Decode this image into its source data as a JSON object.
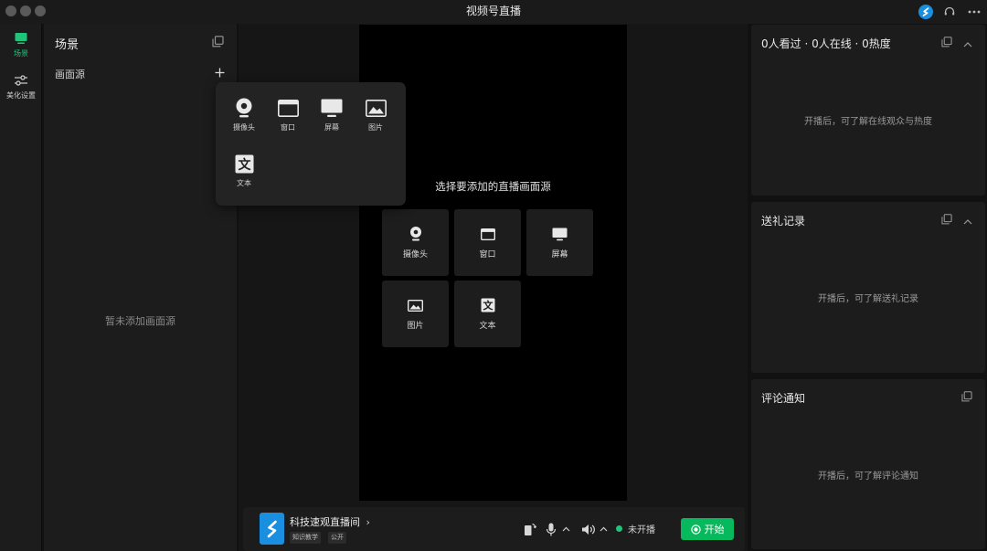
{
  "app": {
    "title": "视频号直播"
  },
  "sidebar": {
    "items": [
      {
        "label": "场景",
        "icon": "scene-icon",
        "active": true
      },
      {
        "label": "美化设置",
        "icon": "beauty-settings-icon",
        "active": false
      }
    ]
  },
  "scene_panel": {
    "title": "场景",
    "sources_label": "画面源",
    "empty_text": "暂未添加画面源"
  },
  "source_popup": {
    "items": [
      {
        "label": "摄像头",
        "icon": "camera-icon"
      },
      {
        "label": "窗口",
        "icon": "window-icon"
      },
      {
        "label": "屏幕",
        "icon": "screen-icon"
      },
      {
        "label": "图片",
        "icon": "image-icon"
      },
      {
        "label": "文本",
        "icon": "text-icon"
      }
    ]
  },
  "preview": {
    "prompt": "选择要添加的直播画面源",
    "tiles": [
      {
        "label": "摄像头",
        "icon": "camera-icon"
      },
      {
        "label": "窗口",
        "icon": "window-icon"
      },
      {
        "label": "屏幕",
        "icon": "screen-icon"
      },
      {
        "label": "图片",
        "icon": "image-icon"
      },
      {
        "label": "文本",
        "icon": "text-icon"
      }
    ]
  },
  "bottom_bar": {
    "room_name": "科技速观直播间",
    "room_chevron": "›",
    "tags": [
      "知识教学",
      "公开"
    ],
    "status": "未开播",
    "start_label": "开始",
    "colors": {
      "accent": "#07b85d",
      "status_dot": "#1fc67a",
      "logo": "#1a8fe0"
    }
  },
  "right_panel": {
    "stats": {
      "title": "0人看过 · 0人在线 · 0热度",
      "empty": "开播后，可了解在线观众与热度"
    },
    "gifts": {
      "title": "送礼记录",
      "empty": "开播后，可了解送礼记录"
    },
    "comments": {
      "title": "评论通知",
      "empty": "开播后，可了解评论通知"
    }
  }
}
